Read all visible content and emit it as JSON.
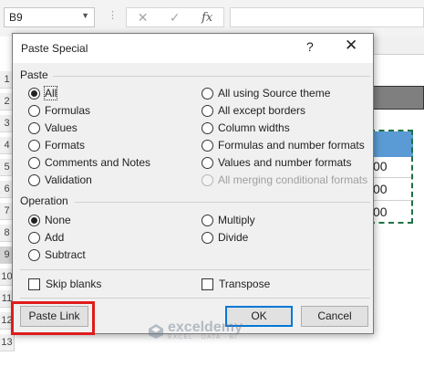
{
  "excel": {
    "name_box": "B9",
    "formula_dots": "⋮",
    "fx_label": "fx",
    "row_numbers": [
      "1",
      "2",
      "3",
      "4",
      "5",
      "6",
      "7",
      "8",
      "9",
      "10",
      "11",
      "12",
      "13"
    ],
    "cell_values": [
      "00",
      "00",
      "00"
    ],
    "accent_colors": {
      "header_blue": "#5b9bd5",
      "copy_border": "#1e7145"
    }
  },
  "dialog": {
    "title": "Paste Special",
    "help": "?",
    "close": "✕",
    "paste_section": "Paste",
    "paste_options_left": [
      {
        "label": "All",
        "checked": true
      },
      {
        "label": "Formulas",
        "checked": false
      },
      {
        "label": "Values",
        "checked": false
      },
      {
        "label": "Formats",
        "checked": false
      },
      {
        "label": "Comments and Notes",
        "checked": false
      },
      {
        "label": "Validation",
        "checked": false
      }
    ],
    "paste_options_right": [
      {
        "label": "All using Source theme",
        "checked": false
      },
      {
        "label": "All except borders",
        "checked": false
      },
      {
        "label": "Column widths",
        "checked": false
      },
      {
        "label": "Formulas and number formats",
        "checked": false
      },
      {
        "label": "Values and number formats",
        "checked": false
      },
      {
        "label": "All merging conditional formats",
        "checked": false,
        "disabled": true
      }
    ],
    "operation_section": "Operation",
    "operation_left": [
      {
        "label": "None",
        "checked": true
      },
      {
        "label": "Add",
        "checked": false
      },
      {
        "label": "Subtract",
        "checked": false
      }
    ],
    "operation_right": [
      {
        "label": "Multiply",
        "checked": false
      },
      {
        "label": "Divide",
        "checked": false
      }
    ],
    "skip_blanks": "Skip blanks",
    "transpose": "Transpose",
    "paste_link_button": "Paste Link",
    "ok_button": "OK",
    "cancel_button": "Cancel",
    "highlight_color": "#e01b1b"
  },
  "watermark": {
    "name": "exceldemy",
    "tagline": "EXCEL · DATA · BI"
  }
}
